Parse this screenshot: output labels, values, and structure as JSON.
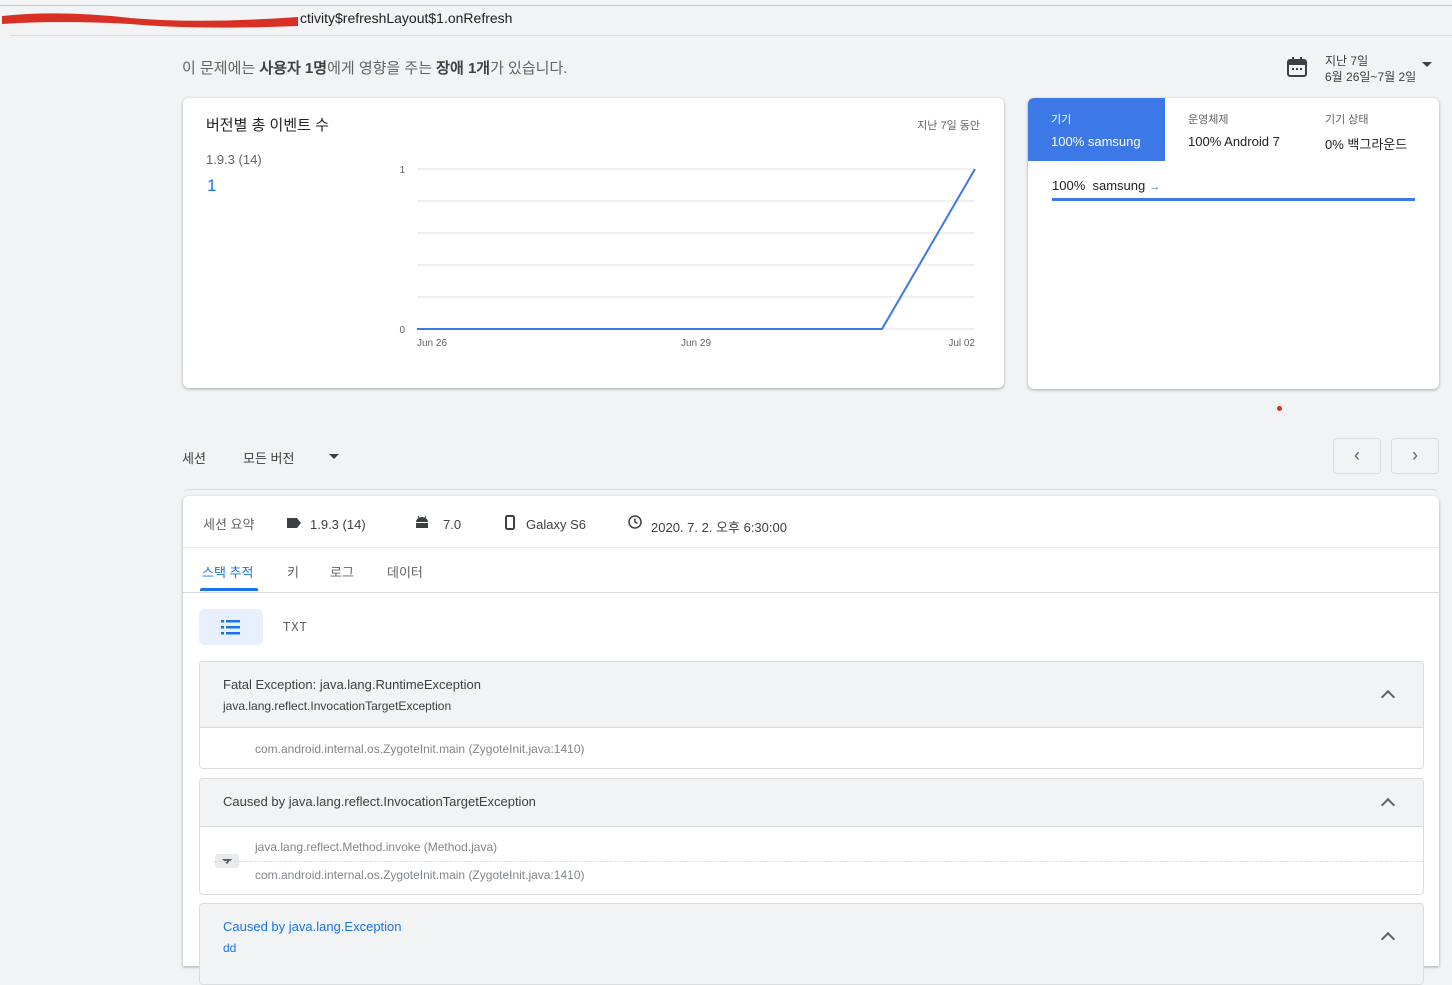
{
  "header": {
    "title_suffix": "ctivity$refreshLayout$1.onRefresh"
  },
  "summary": {
    "part1": "이 문제에는 ",
    "users": "사용자 1명",
    "part2": "에게 영향을 주는 ",
    "crashes": "장애 1개",
    "part3": "가 있습니다."
  },
  "date_range": {
    "line1": "지난 7일",
    "line2": "6월 26일~7월 2일"
  },
  "events_card": {
    "title": "버전별 총 이벤트 수",
    "period": "지난 7일 동안",
    "version": "1.9.3 (14)",
    "count": "1"
  },
  "chart_data": {
    "type": "line",
    "x_tick_labels": [
      "Jun 26",
      "Jun 29",
      "Jul 02"
    ],
    "y_tick_labels": [
      "1",
      "0"
    ],
    "ylim": [
      0,
      1
    ],
    "series": [
      {
        "name": "1.9.3 (14)",
        "x": [
          "Jun 26",
          "Jun 27",
          "Jun 28",
          "Jun 29",
          "Jun 30",
          "Jul 01",
          "Jul 02"
        ],
        "values": [
          0,
          0,
          0,
          0,
          0,
          0,
          1
        ]
      }
    ],
    "grid": true,
    "color": "#3c78e6"
  },
  "device_card": {
    "tabs": [
      {
        "label": "기기",
        "value": "100% samsung",
        "active": true
      },
      {
        "label": "운영체제",
        "value": "100% Android 7",
        "active": false
      },
      {
        "label": "기기 상태",
        "value": "0% 백그라운드",
        "active": false
      }
    ],
    "row_percent": "100%",
    "row_name": "samsung",
    "row_arrow": "→",
    "bar_fraction": 1.0
  },
  "session_bar": {
    "label": "세션",
    "version_select": "모든 버전",
    "prev": "‹",
    "next": "›"
  },
  "session": {
    "summary_label": "세션 요약",
    "app_version": "1.9.3 (14)",
    "android_version": "7.0",
    "device": "Galaxy S6",
    "time": "2020. 7. 2. 오후 6:30:00",
    "tabs": [
      "스택 추적",
      "키",
      "로그",
      "데이터"
    ],
    "txt_label": "TXT"
  },
  "exceptions": [
    {
      "title": "Fatal Exception: java.lang.RuntimeException",
      "subtitle": "java.lang.reflect.InvocationTargetException",
      "frames": [
        "com.android.internal.os.ZygoteInit.main (ZygoteInit.java:1410)"
      ]
    },
    {
      "title": "Caused by java.lang.reflect.InvocationTargetException",
      "frames": [
        "java.lang.reflect.Method.invoke (Method.java)",
        "com.android.internal.os.ZygoteInit.main (ZygoteInit.java:1410)"
      ]
    },
    {
      "title": "Caused by java.lang.Exception",
      "subtitle": "dd"
    }
  ],
  "colors": {
    "accent": "#1a73e8",
    "chart_line": "#3c78e6",
    "redaction": "#d93025"
  }
}
